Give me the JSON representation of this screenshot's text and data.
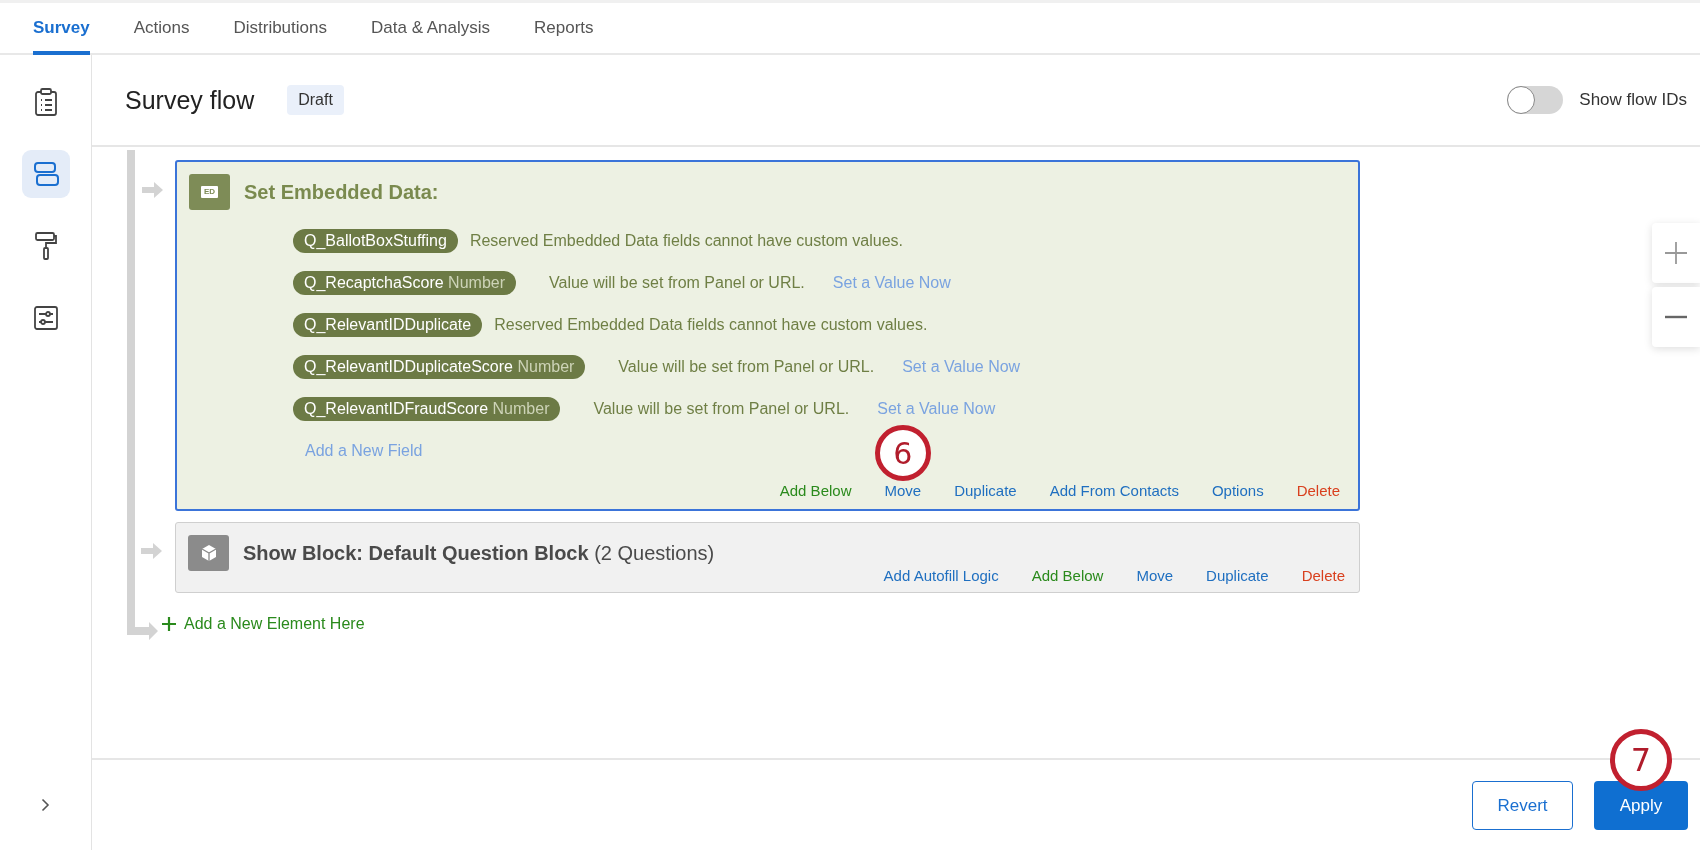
{
  "tabs": [
    {
      "label": "Survey",
      "selected": true
    },
    {
      "label": "Actions",
      "selected": false
    },
    {
      "label": "Distributions",
      "selected": false
    },
    {
      "label": "Data & Analysis",
      "selected": false
    },
    {
      "label": "Reports",
      "selected": false
    }
  ],
  "sidebar": {
    "items": [
      {
        "kind": "survey",
        "selected": false
      },
      {
        "kind": "flow",
        "selected": true
      },
      {
        "kind": "look",
        "selected": false
      },
      {
        "kind": "options",
        "selected": false
      }
    ]
  },
  "header": {
    "title": "Survey flow",
    "badge": "Draft",
    "show_flow_ids": {
      "label": "Show flow IDs",
      "on": false
    }
  },
  "flow": {
    "elements": [
      {
        "kind": "embedded_data",
        "selected": true,
        "icon_label": "ED",
        "title": "Set Embedded Data:",
        "fields": [
          {
            "name": "Q_BallotBoxStuffing",
            "note": "Reserved Embedded Data fields cannot have custom values."
          },
          {
            "name": "Q_RecaptchaScore",
            "type": "Number",
            "note": "Value will be set from Panel or URL.",
            "link": "Set a Value Now"
          },
          {
            "name": "Q_RelevantIDDuplicate",
            "note": "Reserved Embedded Data fields cannot have custom values."
          },
          {
            "name": "Q_RelevantIDDuplicateScore",
            "type": "Number",
            "note": "Value will be set from Panel or URL.",
            "link": "Set a Value Now"
          },
          {
            "name": "Q_RelevantIDFraudScore",
            "type": "Number",
            "note": "Value will be set from Panel or URL.",
            "link": "Set a Value Now"
          }
        ],
        "add_field": "Add a New Field",
        "actions": [
          {
            "label": "Add Below",
            "kind": "add"
          },
          {
            "label": "Move",
            "kind": "action",
            "callout": "6"
          },
          {
            "label": "Duplicate",
            "kind": "action"
          },
          {
            "label": "Add From Contacts",
            "kind": "action"
          },
          {
            "label": "Options",
            "kind": "action"
          },
          {
            "label": "Delete",
            "kind": "danger"
          }
        ]
      },
      {
        "kind": "block",
        "selected": false,
        "title": "**Show Block: Default Question Block** (2 Questions)",
        "actions": [
          {
            "label": "Add Autofill Logic",
            "kind": "action"
          },
          {
            "label": "Add Below",
            "kind": "add"
          },
          {
            "label": "Move",
            "kind": "action"
          },
          {
            "label": "Duplicate",
            "kind": "action"
          },
          {
            "label": "Delete",
            "kind": "danger"
          }
        ]
      }
    ],
    "add_element": "Add a New Element Here"
  },
  "footer": {
    "buttons": [
      {
        "label": "Revert",
        "kind": "secondary"
      },
      {
        "label": "Apply",
        "kind": "primary",
        "callout": "7"
      }
    ]
  }
}
